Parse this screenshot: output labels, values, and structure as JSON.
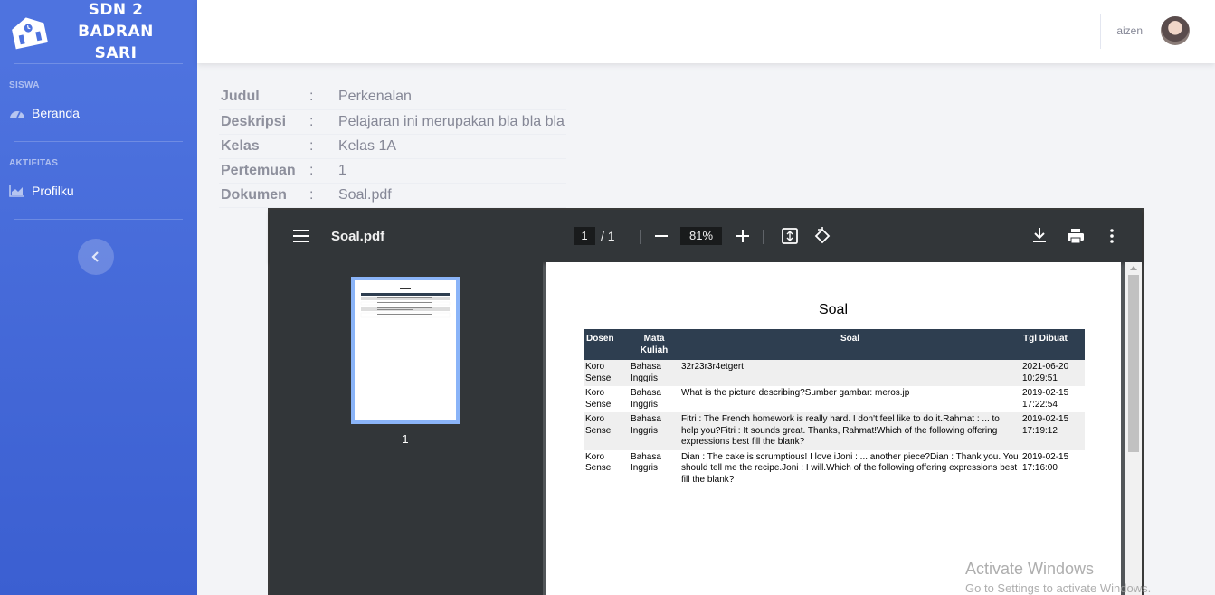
{
  "brand": {
    "line1": "SDN 2",
    "line2": "BADRAN",
    "line3": "SARI",
    "logo_icon": "school-icon"
  },
  "sidebar": {
    "sections": [
      {
        "heading": "SISWA",
        "items": [
          {
            "label": "Beranda",
            "icon": "tachometer-icon"
          }
        ]
      },
      {
        "heading": "AKTIFITAS",
        "items": [
          {
            "label": "Profilku",
            "icon": "chart-area-icon"
          }
        ]
      }
    ],
    "toggle_icon": "chevron-left-icon"
  },
  "topbar": {
    "username": "aizen",
    "avatar_icon": "user-avatar"
  },
  "info": [
    {
      "key": "Judul",
      "sep": ":",
      "value": "Perkenalan"
    },
    {
      "key": "Deskripsi",
      "sep": ":",
      "value": "Pelajaran ini merupakan bla bla bla"
    },
    {
      "key": "Kelas",
      "sep": ":",
      "value": "Kelas 1A"
    },
    {
      "key": "Pertemuan",
      "sep": ":",
      "value": "1"
    },
    {
      "key": "Dokumen",
      "sep": ":",
      "value": "Soal.pdf"
    }
  ],
  "pdf": {
    "filename": "Soal.pdf",
    "page_current": "1",
    "page_total": "/  1",
    "zoom": "81%",
    "thumb_label": "1",
    "doc_title": "Soal",
    "columns": [
      "Dosen",
      "Mata Kuliah",
      "Soal",
      "Tgl Dibuat"
    ],
    "rows": [
      {
        "dosen": "Koro Sensei",
        "mk": "Bahasa Inggris",
        "soal": "32r23r3r4etgert",
        "tgl": "2021-06-20 10:29:51"
      },
      {
        "dosen": "Koro Sensei",
        "mk": "Bahasa Inggris",
        "soal": "What is the picture describing?Sumber gambar: meros.jp",
        "tgl": "2019-02-15 17:22:54"
      },
      {
        "dosen": "Koro Sensei",
        "mk": "Bahasa Inggris",
        "soal": "Fitri : The French homework is really hard. I don't feel like to do it.Rahmat : ... to help you?Fitri : It sounds great. Thanks, Rahmat!Which of the following offering expressions best fill the blank?",
        "tgl": "2019-02-15 17:19:12"
      },
      {
        "dosen": "Koro Sensei",
        "mk": "Bahasa Inggris",
        "soal": "Dian : The cake is scrumptious! I love iJoni : ... another piece?Dian : Thank you. You should tell me the recipe.Joni : I will.Which of the following offering expressions best fill the blank?",
        "tgl": "2019-02-15 17:16:00"
      }
    ]
  },
  "watermark": {
    "line1": "Activate Windows",
    "line2": "Go to Settings to activate Windows."
  }
}
